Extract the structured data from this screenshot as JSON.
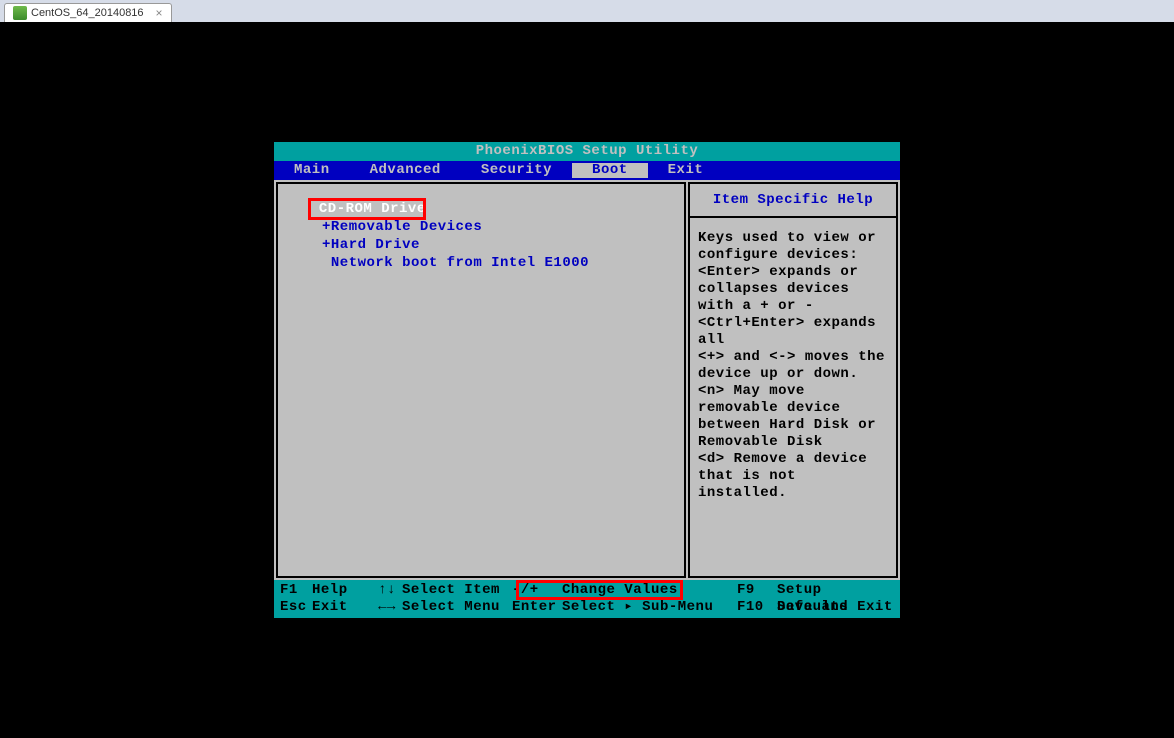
{
  "tab": {
    "title": "CentOS_64_20140816"
  },
  "bios": {
    "title": "PhoenixBIOS Setup Utility",
    "menu": [
      "Main",
      "Advanced",
      "Security",
      "Boot",
      "Exit"
    ],
    "active_menu": "Boot",
    "boot_order": [
      {
        "label": " CD-ROM Drive",
        "selected": true
      },
      {
        "label": "+Removable Devices",
        "selected": false
      },
      {
        "label": "+Hard Drive",
        "selected": false
      },
      {
        "label": " Network boot from Intel E1000",
        "selected": false
      }
    ],
    "help_title": "Item Specific Help",
    "help_text": "Keys used to view or configure devices:\n<Enter> expands or collapses devices with a + or -\n<Ctrl+Enter> expands all\n<+> and <-> moves the device up or down.\n<n> May move removable device between Hard Disk or Removable Disk\n<d> Remove a device that is not installed.",
    "footer": {
      "row1": {
        "k1": "F1",
        "a1": "Help",
        "s1": "↑↓",
        "l1": "Select Item",
        "k2": "-/+",
        "a2": "Change Values",
        "k3": "F9",
        "a3": "Setup Defaults"
      },
      "row2": {
        "k1": "Esc",
        "a1": "Exit",
        "s1": "←→",
        "l1": "Select Menu",
        "k2": "Enter",
        "a2": "Select ▸ Sub-Menu",
        "k3": "F10",
        "a3": "Save and Exit"
      }
    }
  }
}
